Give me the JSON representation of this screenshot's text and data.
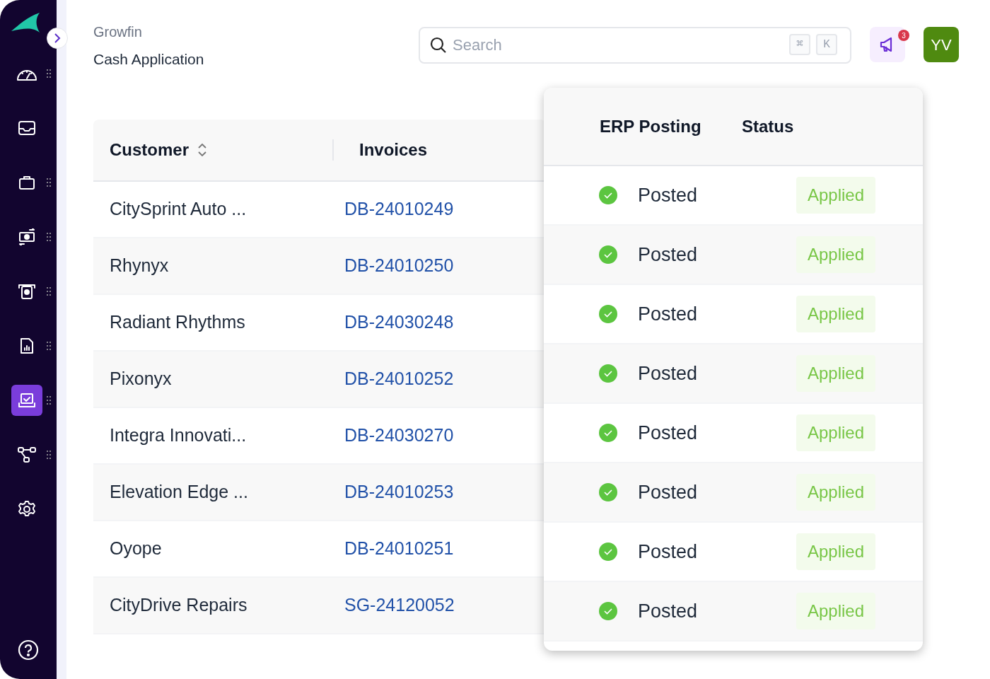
{
  "sidebar": {
    "items": [
      {
        "selected": false,
        "handle": true
      },
      {
        "selected": false,
        "handle": false
      },
      {
        "selected": false,
        "handle": true
      },
      {
        "selected": false,
        "handle": true
      },
      {
        "selected": false,
        "handle": true
      },
      {
        "selected": false,
        "handle": true
      },
      {
        "selected": true,
        "handle": true
      },
      {
        "selected": false,
        "handle": true
      },
      {
        "selected": false,
        "handle": false
      }
    ]
  },
  "header": {
    "breadcrumb": "Growfin",
    "title": "Cash Application",
    "search": {
      "placeholder": "Search",
      "keys": [
        "⌘",
        "K"
      ]
    },
    "notification_count": "3",
    "avatar": "YV"
  },
  "table": {
    "columns": [
      {
        "label": "Customer",
        "sortable": true
      },
      {
        "label": "Invoices",
        "sortable": false
      }
    ],
    "overlay_columns": [
      "ERP Posting",
      "Status"
    ],
    "rows": [
      {
        "customer": "CitySprint Auto ...",
        "invoice": "DB-24010249",
        "erp_posting": "Posted",
        "status": "Applied"
      },
      {
        "customer": "Rhynyx",
        "invoice": "DB-24010250",
        "erp_posting": "Posted",
        "status": "Applied"
      },
      {
        "customer": "Radiant Rhythms",
        "invoice": "DB-24030248",
        "erp_posting": "Posted",
        "status": "Applied"
      },
      {
        "customer": "Pixonyx",
        "invoice": "DB-24010252",
        "erp_posting": "Posted",
        "status": "Applied"
      },
      {
        "customer": "Integra Innovati...",
        "invoice": "DB-24030270",
        "erp_posting": "Posted",
        "status": "Applied"
      },
      {
        "customer": "Elevation Edge ...",
        "invoice": "DB-24010253",
        "erp_posting": "Posted",
        "status": "Applied"
      },
      {
        "customer": "Oyope",
        "invoice": "DB-24010251",
        "erp_posting": "Posted",
        "status": "Applied"
      },
      {
        "customer": "CityDrive Repairs",
        "invoice": "SG-24120052",
        "erp_posting": "Posted",
        "status": "Applied"
      }
    ]
  }
}
